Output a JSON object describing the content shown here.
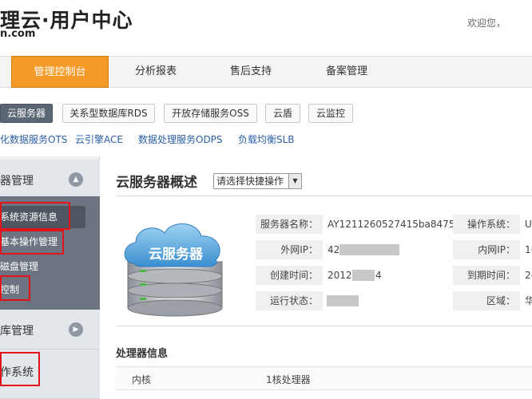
{
  "header": {
    "logo_main": "理云·用户中心",
    "logo_sub": "n.com",
    "welcome": "欢迎您，"
  },
  "main_nav": {
    "items": [
      {
        "label": "管理控制台",
        "active": true
      },
      {
        "label": "分析报表",
        "active": false
      },
      {
        "label": "售后支持",
        "active": false
      },
      {
        "label": "备案管理",
        "active": false
      }
    ]
  },
  "product_tabs": [
    {
      "label": "云服务器",
      "active": true
    },
    {
      "label": "关系型数据库RDS"
    },
    {
      "label": "开放存储服务OSS"
    },
    {
      "label": "云盾"
    },
    {
      "label": "云监控"
    }
  ],
  "product_links": [
    "化数据服务OTS",
    "云引擎ACE",
    "数据处理服务ODPS",
    "负载均衡SLB"
  ],
  "sidebar": {
    "group1_title": "器管理",
    "group1_toggle_icon": "chevron-up-icon",
    "items": [
      {
        "label": "系统资源信息",
        "active": true
      },
      {
        "label": "基本操作管理"
      },
      {
        "label": "磁盘管理"
      },
      {
        "label": "控制"
      }
    ],
    "group2_title": "库管理",
    "group2_toggle_icon": "chevron-right-icon",
    "group3_title": "作系统"
  },
  "content": {
    "title": "云服务器概述",
    "quick_select": "请选择快捷操作",
    "server_image_label": "云服务器",
    "info": {
      "name_label": "服务器名称：",
      "name_value": "AY1211260527415ba8475",
      "os_label": "操作系统：",
      "os_value": "U",
      "public_ip_label": "外网IP：",
      "public_ip_value": "42",
      "private_ip_label": "内网IP：",
      "private_ip_value": "1(",
      "created_label": "创建时间：",
      "created_value": "2012",
      "created_tail": "4",
      "expire_label": "到期时间：",
      "expire_value": "2(",
      "status_label": "运行状态：",
      "region_label": "区域：",
      "region_value": "华"
    },
    "cpu_section_title": "处理器信息",
    "cpu_row": {
      "col1": "内核",
      "col2": "1核处理器"
    }
  }
}
